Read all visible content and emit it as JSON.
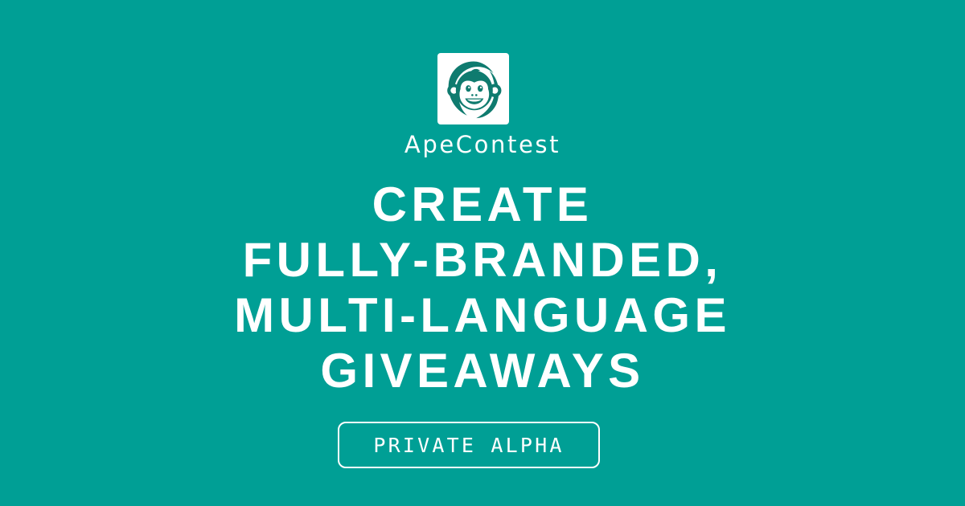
{
  "colors": {
    "background": "#009f95",
    "foreground": "#ffffff",
    "logo_mark": "#0f7b6f"
  },
  "logo": {
    "icon": "monkey-face-icon"
  },
  "brand": {
    "name": "ApeContest"
  },
  "headline": {
    "lines": [
      "CREATE",
      "FULLY-BRANDED,",
      "MULTI-LANGUAGE",
      "GIVEAWAYS"
    ]
  },
  "badge": {
    "label": "PRIVATE ALPHA"
  }
}
